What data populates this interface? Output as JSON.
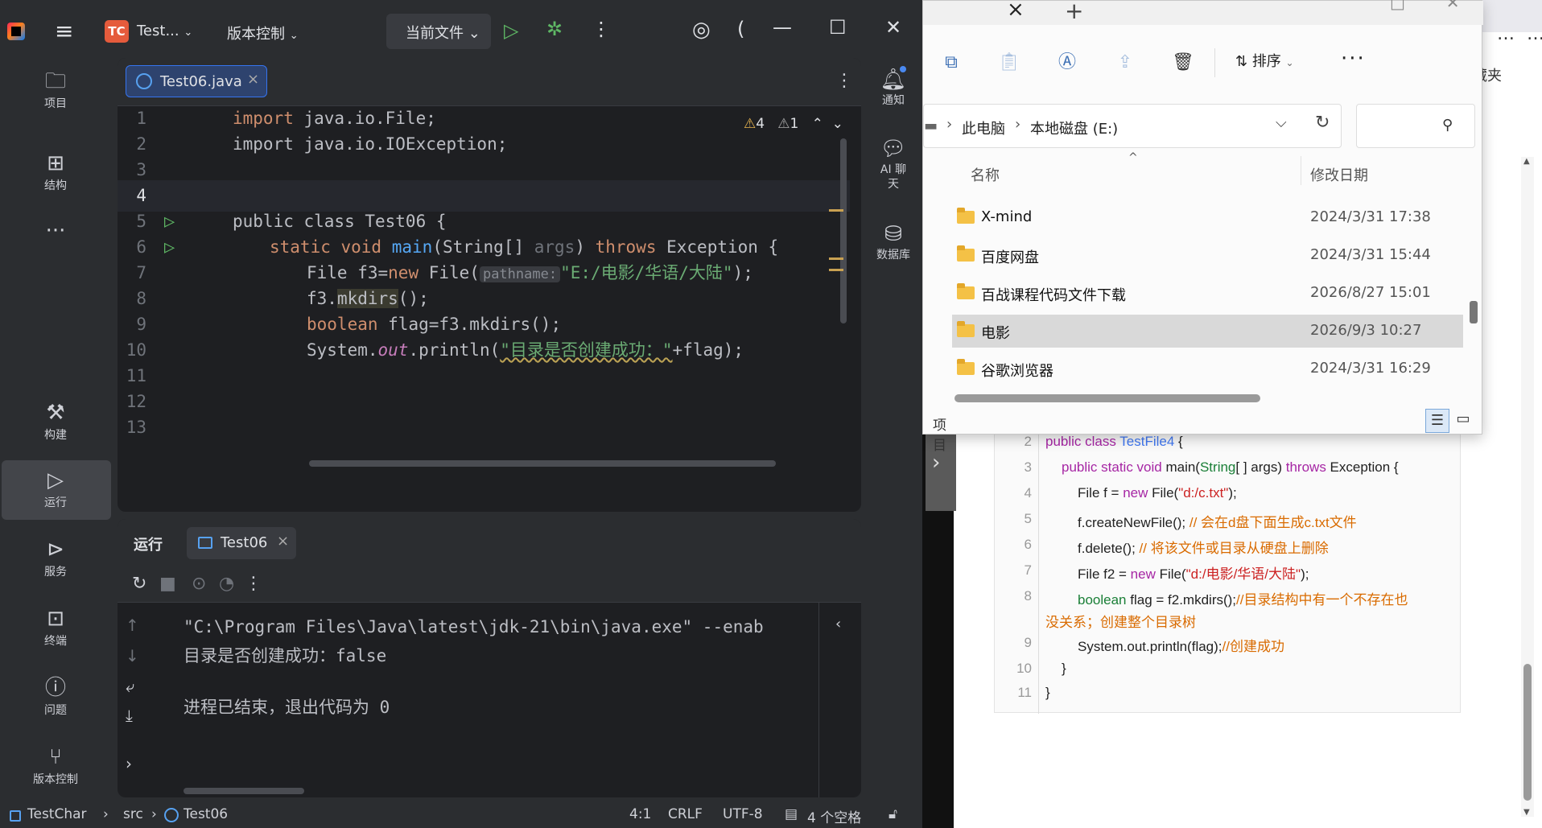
{
  "ide": {
    "project_badge": "TC",
    "project_name": "Test...",
    "vcs_menu": "版本控制",
    "run_config": "当前文件",
    "left_tools": [
      {
        "label": "项目"
      },
      {
        "label": "结构"
      },
      {
        "label": "构建"
      },
      {
        "label": "运行"
      },
      {
        "label": "服务"
      },
      {
        "label": "终端"
      },
      {
        "label": "问题"
      },
      {
        "label": "版本控制"
      }
    ],
    "right_tools": [
      {
        "label": "通知"
      },
      {
        "label": "AI 聊天"
      },
      {
        "label": "数据库"
      }
    ],
    "editor": {
      "tab_name": "Test06.java",
      "warnings": "4",
      "weak_warnings": "1",
      "line_numbers": [
        "1",
        "2",
        "3",
        "4",
        "5",
        "6",
        "7",
        "8",
        "9",
        "10",
        "11",
        "12",
        "13"
      ],
      "code": {
        "l1_kw": "import",
        "l1_rest": " java.io.File;",
        "l2": "import java.io.IOException;",
        "l5_kw": "public class",
        "l5_rest": " Test06 {",
        "l6_kw1": "static void",
        "l6_fn": "main",
        "l6_args": "(String[] ",
        "l6_param": "args",
        "l6_close": ") ",
        "l6_kw2": "throws",
        "l6_rest": " Exception {",
        "l7_a": "File f3=",
        "l7_kw": "new",
        "l7_b": " File(",
        "l7_hint": "pathname:",
        "l7_str": "\"E:/电影/华语/大陆\"",
        "l7_end": ");",
        "l8_a": "f3.",
        "l8_fn": "mkdirs",
        "l8_end": "();",
        "l9_kw": "boolean",
        "l9_rest": " flag=f3.mkdirs();",
        "l10_a": "System.",
        "l10_out": "out",
        "l10_b": ".println(",
        "l10_str": "\"目录是否创建成功：\"",
        "l10_end": "+flag);"
      }
    },
    "run_panel": {
      "title": "运行",
      "tab_name": "Test06",
      "console": [
        "\"C:\\Program Files\\Java\\latest\\jdk-21\\bin\\java.exe\" --enab",
        "目录是否创建成功：false",
        "",
        "进程已结束，退出代码为 0"
      ]
    },
    "status_bar": {
      "project": "TestChar",
      "src": "src",
      "file": "Test06",
      "position": "4:1",
      "line_sep": "CRLF",
      "encoding": "UTF-8",
      "indent": "4 个空格"
    }
  },
  "explorer": {
    "toolbar": {
      "sort_label": "排序"
    },
    "breadcrumb": [
      "此电脑",
      "本地磁盘 (E:)"
    ],
    "columns": {
      "name": "名称",
      "date": "修改日期"
    },
    "rows": [
      {
        "name": "X-mind",
        "date": "2024/3/31 17:38"
      },
      {
        "name": "百度网盘",
        "date": "2024/3/31 15:44"
      },
      {
        "name": "百战课程代码文件下载",
        "date": "2026/8/27 15:01"
      },
      {
        "name": "电影",
        "date": "2026/9/3 10:27",
        "selected": true
      },
      {
        "name": "谷歌浏览器",
        "date": "2024/3/31 16:29"
      }
    ],
    "status_text": "项目"
  },
  "browser": {
    "bookmark_label": "收藏夹",
    "code_lines": [
      {
        "n": "2",
        "t": "public class TestFile4 {"
      },
      {
        "n": "3",
        "t": "public static void main(String[ ] args) throws Exception {"
      },
      {
        "n": "4",
        "t": "File f = new File(\"d:/c.txt\");"
      },
      {
        "n": "5",
        "t": "f.createNewFile(); // 会在d盘下面生成c.txt文件"
      },
      {
        "n": "6",
        "t": "f.delete(); // 将该文件或目录从硬盘上删除"
      },
      {
        "n": "7",
        "t": "File f2 = new File(\"d:/电影/华语/大陆\");"
      },
      {
        "n": "8",
        "t": "boolean flag = f2.mkdirs();//目录结构中有一个不存在也"
      },
      {
        "n": "",
        "t": "没关系；创建整个目录树"
      },
      {
        "n": "9",
        "t": "System.out.println(flag);//创建成功"
      },
      {
        "n": "10",
        "t": "}"
      },
      {
        "n": "11",
        "t": "}"
      }
    ]
  }
}
